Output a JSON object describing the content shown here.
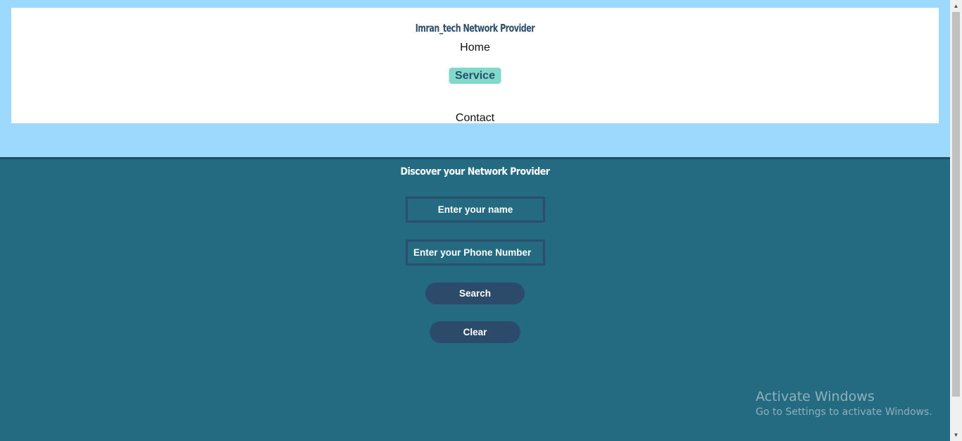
{
  "header": {
    "site_title": "Imran_tech Network Provider",
    "nav": {
      "home": "Home",
      "service": "Service",
      "contact": "Contact"
    }
  },
  "main": {
    "title": "Discover your Network Provider",
    "name_field": {
      "placeholder": "Enter your name",
      "value": ""
    },
    "phone_field": {
      "placeholder": "Enter your Phone Number",
      "value": ""
    },
    "search_button": "Search",
    "clear_button": "Clear"
  },
  "watermark": {
    "title": "Activate Windows",
    "subtitle": "Go to Settings to activate Windows."
  },
  "colors": {
    "top_band": "#9cd9fc",
    "header_card": "#ffffff",
    "brand_text": "#2c4d6c",
    "active_nav": "#80d9c9",
    "main_background": "#246b82",
    "button": "#2c4b6a"
  },
  "icons": {
    "scroll_up": "scroll-up-arrow-icon",
    "scroll_down": "scroll-down-arrow-icon"
  }
}
